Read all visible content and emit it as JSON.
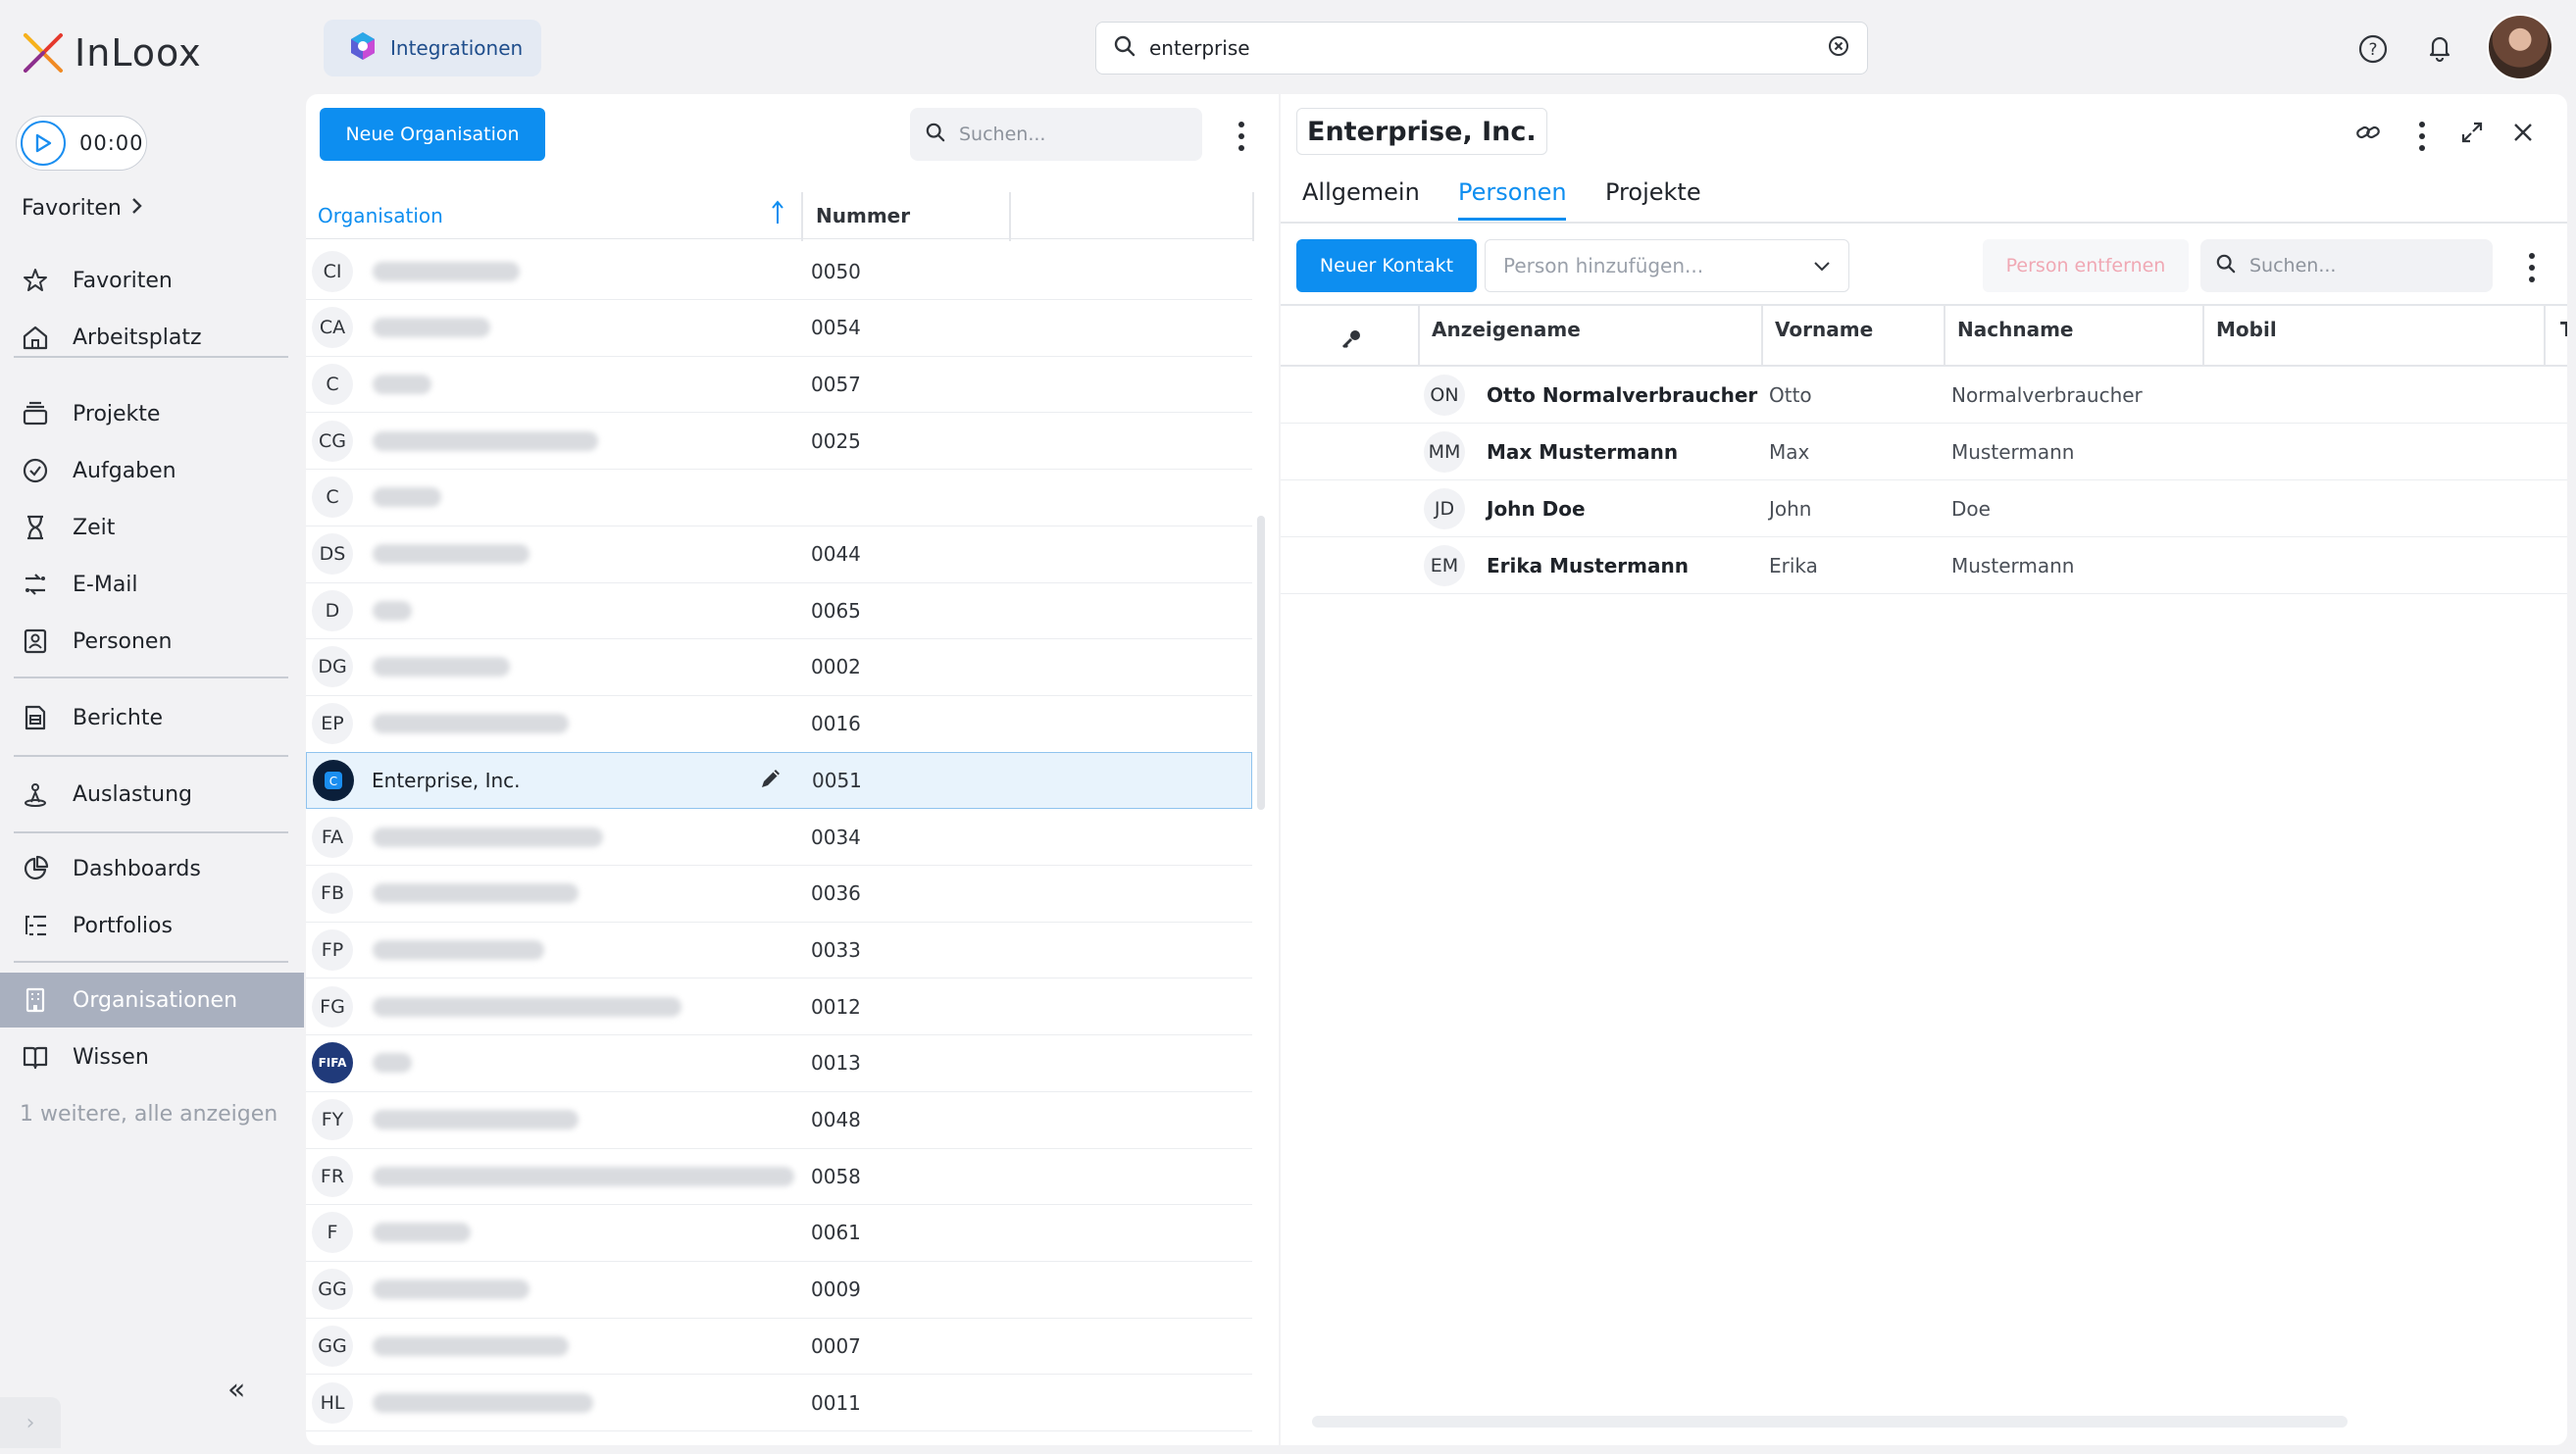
{
  "app": {
    "name": "InLoox",
    "integrations_tab": "Integrationen",
    "search_value": "enterprise",
    "timer": "00:00"
  },
  "sidebar": {
    "favorites_header": "Favoriten",
    "groups": [
      [
        {
          "label": "Favoriten",
          "icon": "star-icon"
        },
        {
          "label": "Arbeitsplatz",
          "icon": "home-icon"
        }
      ],
      [
        {
          "label": "Projekte",
          "icon": "projects-icon"
        },
        {
          "label": "Aufgaben",
          "icon": "check-circle-icon"
        },
        {
          "label": "Zeit",
          "icon": "hourglass-icon"
        },
        {
          "label": "E-Mail",
          "icon": "mail-flow-icon"
        },
        {
          "label": "Personen",
          "icon": "contact-card-icon"
        }
      ],
      [
        {
          "label": "Berichte",
          "icon": "report-icon"
        }
      ],
      [
        {
          "label": "Auslastung",
          "icon": "workload-icon"
        }
      ],
      [
        {
          "label": "Dashboards",
          "icon": "pie-chart-icon"
        },
        {
          "label": "Portfolios",
          "icon": "portfolio-list-icon"
        }
      ],
      [
        {
          "label": "Organisationen",
          "icon": "building-icon",
          "active": true
        },
        {
          "label": "Wissen",
          "icon": "book-icon"
        }
      ]
    ],
    "more_link": "1 weitere, alle anzeigen"
  },
  "org_list": {
    "new_button": "Neue Organisation",
    "search_placeholder": "Suchen...",
    "col_organisation": "Organisation",
    "col_nummer": "Nummer",
    "rows": [
      {
        "initials": "CI",
        "name": "",
        "number": "0050"
      },
      {
        "initials": "CA",
        "name": "",
        "number": "0054"
      },
      {
        "initials": "C",
        "name": "",
        "number": "0057"
      },
      {
        "initials": "CG",
        "name": "",
        "number": "0025"
      },
      {
        "initials": "C",
        "name": "",
        "number": ""
      },
      {
        "initials": "DS",
        "name": "",
        "number": "0044"
      },
      {
        "initials": "D",
        "name": "",
        "number": "0065"
      },
      {
        "initials": "DG",
        "name": "",
        "number": "0002"
      },
      {
        "initials": "EP",
        "name": "",
        "number": "0016"
      },
      {
        "initials": "",
        "name": "Enterprise, Inc.",
        "number": "0051",
        "selected": true
      },
      {
        "initials": "FA",
        "name": "",
        "number": "0034"
      },
      {
        "initials": "FB",
        "name": "",
        "number": "0036"
      },
      {
        "initials": "FP",
        "name": "",
        "number": "0033"
      },
      {
        "initials": "FG",
        "name": "",
        "number": "0012"
      },
      {
        "initials": "FIFA",
        "name": "",
        "number": "0013",
        "logo": true
      },
      {
        "initials": "FY",
        "name": "",
        "number": "0048"
      },
      {
        "initials": "FR",
        "name": "",
        "number": "0058"
      },
      {
        "initials": "F",
        "name": "",
        "number": "0061"
      },
      {
        "initials": "GG",
        "name": "",
        "number": "0009"
      },
      {
        "initials": "GG",
        "name": "",
        "number": "0007"
      },
      {
        "initials": "HL",
        "name": "",
        "number": "0011"
      }
    ]
  },
  "detail": {
    "title": "Enterprise, Inc.",
    "tabs": [
      "Allgemein",
      "Personen",
      "Projekte"
    ],
    "active_tab": "Personen",
    "new_contact_button": "Neuer Kontakt",
    "add_person_placeholder": "Person hinzufügen...",
    "remove_person_button": "Person entfernen",
    "search_placeholder": "Suchen...",
    "columns": [
      "Anzeigename",
      "Vorname",
      "Nachname",
      "Mobil",
      "T"
    ],
    "people": [
      {
        "initials": "ON",
        "display": "Otto Normalverbraucher",
        "first": "Otto",
        "last": "Normalverbraucher"
      },
      {
        "initials": "MM",
        "display": "Max Mustermann",
        "first": "Max",
        "last": "Mustermann"
      },
      {
        "initials": "JD",
        "display": "John Doe",
        "first": "John",
        "last": "Doe"
      },
      {
        "initials": "EM",
        "display": "Erika Mustermann",
        "first": "Erika",
        "last": "Mustermann"
      }
    ]
  }
}
